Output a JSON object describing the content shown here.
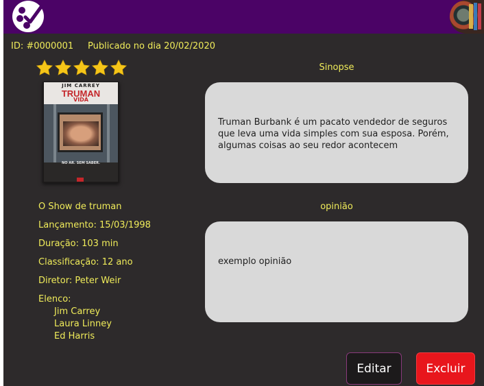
{
  "header": {
    "logo_icon": "film-reel-check-icon",
    "avatar_icon": "user-avatar"
  },
  "meta": {
    "id_text": "ID: #0000001",
    "published_text": "Publicado no dia 20/02/2020"
  },
  "rating": {
    "stars": 5,
    "max": 5,
    "color": "#f5c518"
  },
  "poster": {
    "actor": "JIM CARREY",
    "title_line1": "TRUMAN",
    "title_line2": "VIDA",
    "tag": "NO AR. SEM SABER."
  },
  "movie": {
    "title": "O Show de truman",
    "release": "Lançamento: 15/03/1998",
    "duration": "Duração: 103 min",
    "rating_class": "Classificação: 12 ano",
    "director": "Diretor: Peter Weir",
    "cast_label": "Elenco:",
    "cast": [
      "Jim Carrey",
      "Laura Linney",
      "Ed Harris"
    ]
  },
  "synopsis": {
    "title": "Sinopse",
    "text": "Truman Burbank é um pacato vendedor de seguros que leva uma vida simples com sua esposa. Porém, algumas coisas ao seu redor acontecem"
  },
  "opinion": {
    "title": "opinião",
    "text": "exemplo opinião"
  },
  "actions": {
    "edit_label": "Editar",
    "delete_label": "Excluir"
  },
  "colors": {
    "header_bg": "#4b0366",
    "page_bg": "#2d2a2b",
    "text_accent": "#f0ec5a",
    "delete_btn": "#e8161c"
  }
}
